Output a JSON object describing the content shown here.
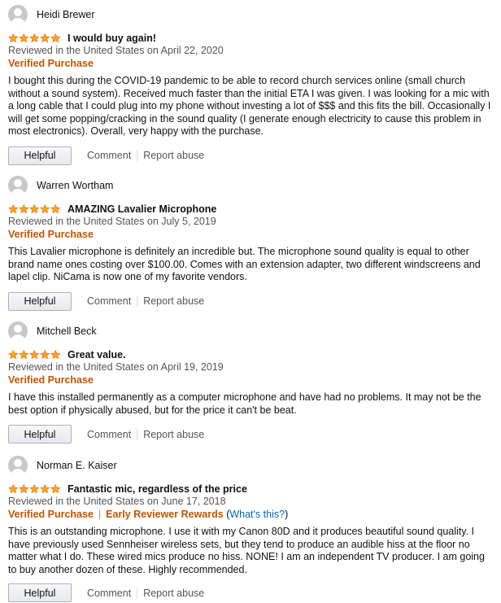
{
  "colors": {
    "star": "#ffa41c",
    "verified": "#c45500",
    "link": "#0066c0"
  },
  "actions": {
    "helpful": "Helpful",
    "comment": "Comment",
    "report": "Report abuse"
  },
  "reviews": [
    {
      "author": "Heidi Brewer",
      "rating": 5,
      "title": "I would buy again!",
      "date": "Reviewed in the United States on April 22, 2020",
      "verified": "Verified Purchase",
      "body": "I bought this during the COVID-19 pandemic to be able to record church services online (small church without a sound system). Received much faster than the initial ETA I was given. I was looking for a mic with a long cable that I could plug into my phone without investing a lot of $$$ and this fits the bill. Occasionally I will get some popping/cracking in the sound quality (I generate enough electricity to cause this problem in most electronics). Overall, very happy with the purchase."
    },
    {
      "author": "Warren Wortham",
      "rating": 5,
      "title": "AMAZING Lavalier Microphone",
      "date": "Reviewed in the United States on July 5, 2019",
      "verified": "Verified Purchase",
      "body": "This Lavalier microphone is definitely an incredible but. The microphone sound quality is equal to other brand name ones costing over $100.00. Comes with an extension adapter, two different windscreens and lapel clip. NiCama is now one of my favorite vendors."
    },
    {
      "author": "Mitchell Beck",
      "rating": 5,
      "title": "Great value.",
      "date": "Reviewed in the United States on April 19, 2019",
      "verified": "Verified Purchase",
      "body": "I have this installed permanently as a computer microphone and have had no problems. It may not be the best option if physically abused, but for the price it can't be beat."
    },
    {
      "author": "Norman E. Kaiser",
      "rating": 5,
      "title": "Fantastic mic, regardless of the price",
      "date": "Reviewed in the United States on June 17, 2018",
      "verified": "Verified Purchase",
      "early_reviewer": "Early Reviewer Rewards",
      "paren_open": "(",
      "whats_this": "What's this?",
      "paren_close": ")",
      "body": "This is an outstanding microphone. I use it with my Canon 80D and it produces beautiful sound quality. I have previously used Sennheiser wireless sets, but they tend to produce an audible hiss at the floor no matter what I do. These wired mics produce no hiss. NONE! I am an independent TV producer. I am going to buy another dozen of these. Highly recommended."
    }
  ]
}
